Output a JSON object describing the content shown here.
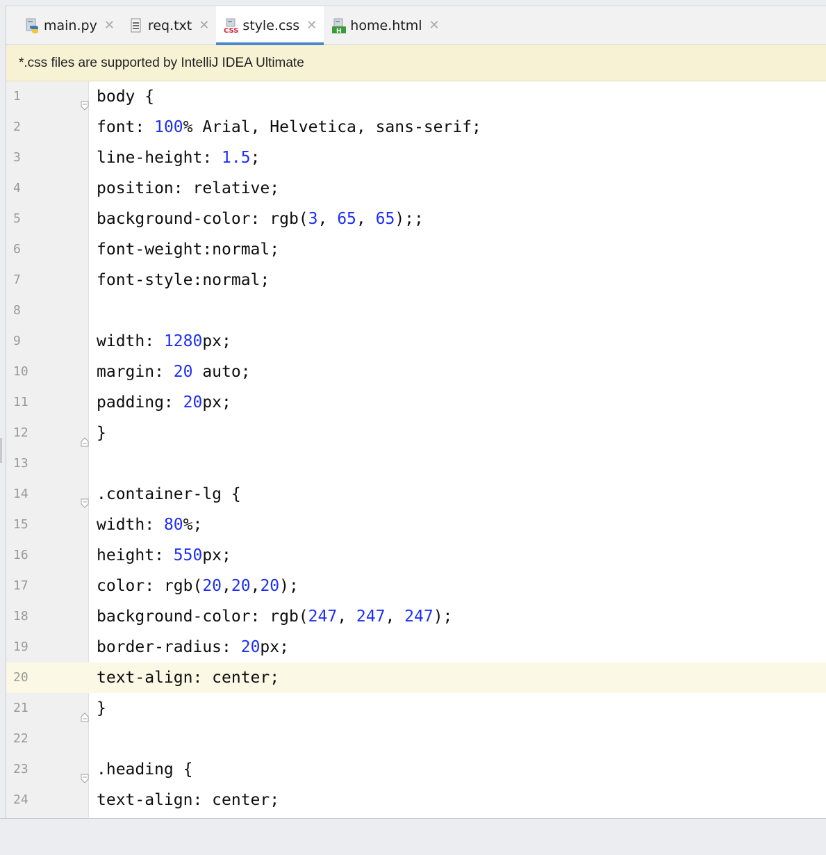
{
  "tabs": [
    {
      "label": "main.py",
      "icon": "python-file-icon",
      "active": false
    },
    {
      "label": "req.txt",
      "icon": "text-file-icon",
      "active": false
    },
    {
      "label": "style.css",
      "icon": "css-file-icon",
      "active": true
    },
    {
      "label": "home.html",
      "icon": "html-file-icon",
      "active": false
    }
  ],
  "tab_close_glyph": "✕",
  "banner": {
    "text": "*.css files are supported by IntelliJ IDEA Ultimate"
  },
  "editor": {
    "current_line": 20,
    "lines": [
      {
        "n": "1",
        "fold": "open",
        "tokens": [
          [
            "t",
            "body {"
          ]
        ]
      },
      {
        "n": "2",
        "tokens": [
          [
            "t",
            "font: "
          ],
          [
            "n",
            "100"
          ],
          [
            "t",
            "% Arial, Helvetica, sans-serif;"
          ]
        ]
      },
      {
        "n": "3",
        "tokens": [
          [
            "t",
            "line-height: "
          ],
          [
            "n",
            "1.5"
          ],
          [
            "t",
            ";"
          ]
        ]
      },
      {
        "n": "4",
        "tokens": [
          [
            "t",
            "position: relative;"
          ]
        ]
      },
      {
        "n": "5",
        "tokens": [
          [
            "t",
            "background-color: rgb("
          ],
          [
            "n",
            "3"
          ],
          [
            "t",
            ", "
          ],
          [
            "n",
            "65"
          ],
          [
            "t",
            ", "
          ],
          [
            "n",
            "65"
          ],
          [
            "t",
            ");;"
          ]
        ]
      },
      {
        "n": "6",
        "tokens": [
          [
            "t",
            "font-weight:normal;"
          ]
        ]
      },
      {
        "n": "7",
        "tokens": [
          [
            "t",
            "font-style:normal;"
          ]
        ]
      },
      {
        "n": "8",
        "tokens": []
      },
      {
        "n": "9",
        "tokens": [
          [
            "t",
            "width: "
          ],
          [
            "n",
            "1280"
          ],
          [
            "t",
            "px;"
          ]
        ]
      },
      {
        "n": "10",
        "tokens": [
          [
            "t",
            "margin: "
          ],
          [
            "n",
            "20"
          ],
          [
            "t",
            " auto;"
          ]
        ]
      },
      {
        "n": "11",
        "tokens": [
          [
            "t",
            "padding: "
          ],
          [
            "n",
            "20"
          ],
          [
            "t",
            "px;"
          ]
        ]
      },
      {
        "n": "12",
        "fold": "close",
        "tokens": [
          [
            "t",
            "}"
          ]
        ]
      },
      {
        "n": "13",
        "tokens": []
      },
      {
        "n": "14",
        "fold": "open",
        "tokens": [
          [
            "t",
            ".container-lg {"
          ]
        ]
      },
      {
        "n": "15",
        "tokens": [
          [
            "t",
            "width: "
          ],
          [
            "n",
            "80"
          ],
          [
            "t",
            "%;"
          ]
        ]
      },
      {
        "n": "16",
        "tokens": [
          [
            "t",
            "height: "
          ],
          [
            "n",
            "550"
          ],
          [
            "t",
            "px;"
          ]
        ]
      },
      {
        "n": "17",
        "tokens": [
          [
            "t",
            "color: rgb("
          ],
          [
            "n",
            "20"
          ],
          [
            "t",
            ","
          ],
          [
            "n",
            "20"
          ],
          [
            "t",
            ","
          ],
          [
            "n",
            "20"
          ],
          [
            "t",
            ");"
          ]
        ]
      },
      {
        "n": "18",
        "tokens": [
          [
            "t",
            "background-color: rgb("
          ],
          [
            "n",
            "247"
          ],
          [
            "t",
            ", "
          ],
          [
            "n",
            "247"
          ],
          [
            "t",
            ", "
          ],
          [
            "n",
            "247"
          ],
          [
            "t",
            ");"
          ]
        ]
      },
      {
        "n": "19",
        "tokens": [
          [
            "t",
            "border-radius: "
          ],
          [
            "n",
            "20"
          ],
          [
            "t",
            "px;"
          ]
        ]
      },
      {
        "n": "20",
        "tokens": [
          [
            "t",
            "text-align: center;"
          ]
        ]
      },
      {
        "n": "21",
        "fold": "close",
        "tokens": [
          [
            "t",
            "}"
          ]
        ]
      },
      {
        "n": "22",
        "tokens": []
      },
      {
        "n": "23",
        "fold": "open",
        "tokens": [
          [
            "t",
            ".heading {"
          ]
        ]
      },
      {
        "n": "24",
        "tokens": [
          [
            "t",
            "text-align: center;"
          ]
        ]
      }
    ]
  },
  "colors": {
    "number": "#1d2ff5",
    "text": "#0d0d0d",
    "line_number": "#999999",
    "banner_bg": "#f7f2d4",
    "current_line_bg": "#fcf8e6",
    "active_tab_underline": "#4a88c7"
  }
}
